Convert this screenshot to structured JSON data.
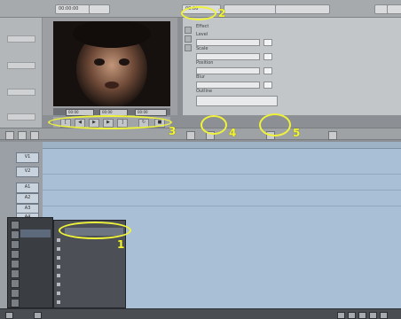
{
  "top_bar": {
    "clip_name": "00:00:00",
    "effect_name": "00:00",
    "field_a": "",
    "field_b": ""
  },
  "monitor": {
    "timecode_in": "00:00",
    "timecode_out": "00:00",
    "timecode_dur": "00:00"
  },
  "effect_editor": {
    "labels": [
      "Effect",
      "Level",
      "Scale",
      "Position",
      "Blur",
      "Outline"
    ]
  },
  "timeline": {
    "tracks": [
      "V1",
      "V2",
      "A1",
      "A2",
      "A3",
      "A4"
    ]
  },
  "context_menu": {
    "items": [
      "",
      "",
      "",
      "",
      "",
      "",
      "",
      "",
      ""
    ]
  },
  "submenu": {
    "items": [
      "",
      "",
      "",
      "",
      "",
      "",
      "",
      "",
      "",
      ""
    ]
  },
  "annotations": [
    "1",
    "2",
    "3",
    "4",
    "5"
  ],
  "colors": {
    "annotation": "#eef23a",
    "timeline_bg": "#a8bfd6",
    "menu_bg": "#3a3d42",
    "menu_highlight": "#5c6a7c"
  }
}
